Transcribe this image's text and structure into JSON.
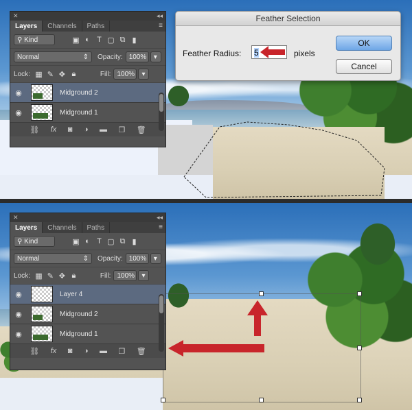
{
  "layers_panel": {
    "tabs": [
      "Layers",
      "Channels",
      "Paths"
    ],
    "filter_kind": "Kind",
    "blend_mode": "Normal",
    "opacity_label": "Opacity:",
    "opacity_value": "100%",
    "lock_label": "Lock:",
    "fill_label": "Fill:",
    "fill_value": "100%",
    "layers_top": [
      "Midground 2",
      "Midground 1"
    ],
    "layers_bottom": [
      "Layer 4",
      "Midground 2",
      "Midground 1"
    ]
  },
  "feather_dialog": {
    "title": "Feather Selection",
    "radius_label": "Feather Radius:",
    "radius_value": "5",
    "unit": "pixels",
    "ok_label": "OK",
    "cancel_label": "Cancel"
  },
  "colors": {
    "arrow": "#c8252b",
    "selected_layer": "#5c6a80",
    "ok_button": "#6ea6e6"
  }
}
